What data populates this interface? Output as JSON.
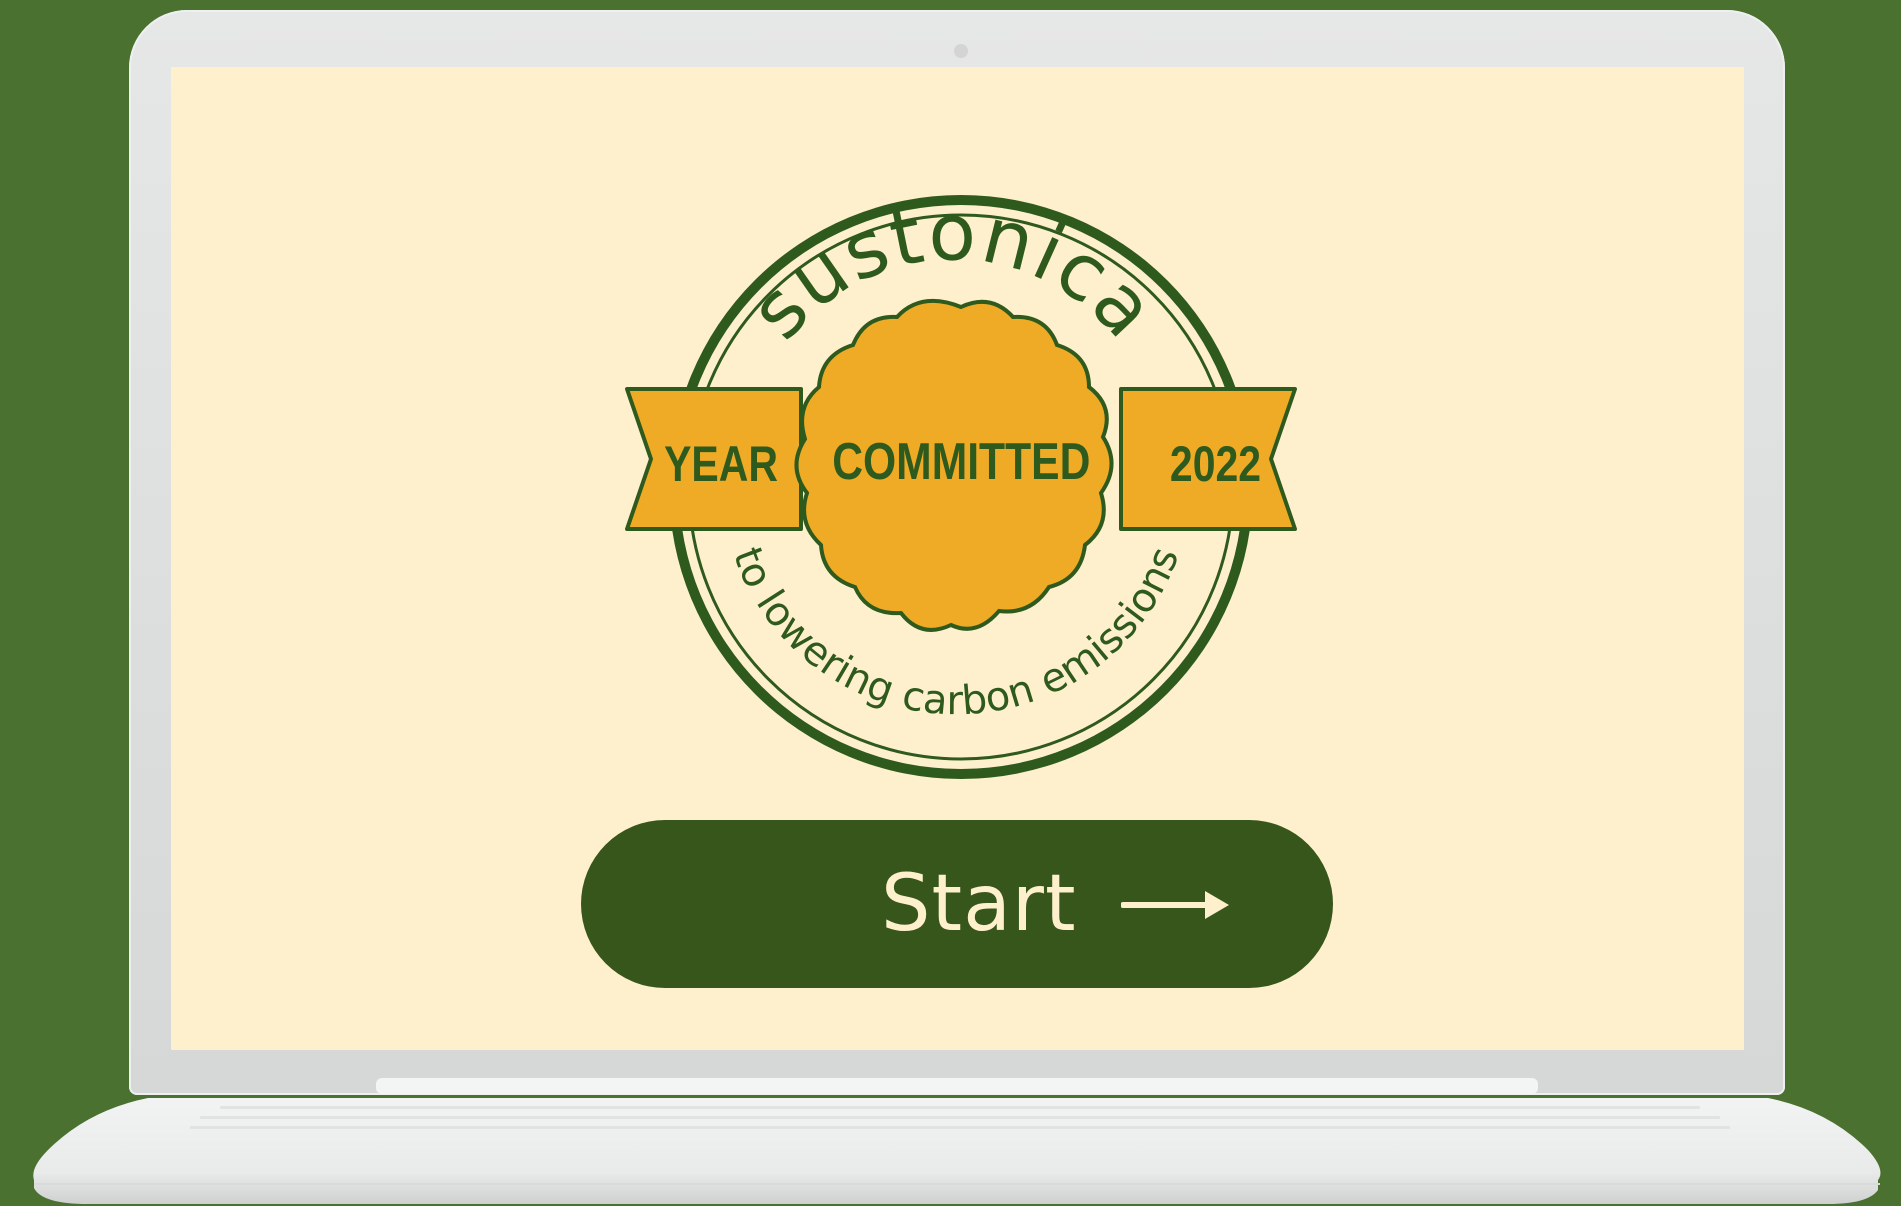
{
  "badge": {
    "brand": "sustonica",
    "ribbon_left": "YEAR",
    "ribbon_center": "COMMITTED",
    "ribbon_right": "2022",
    "bottom_arc": "to lowering carbon emissions"
  },
  "start_button": {
    "label": "Start",
    "icon": "arrow-right-icon"
  },
  "colors": {
    "background": "#4b7130",
    "screen": "#fef0cd",
    "badge_green": "#2f5a1e",
    "badge_gold": "#efab25",
    "button": "#37561b",
    "button_text": "#fef0cd"
  }
}
